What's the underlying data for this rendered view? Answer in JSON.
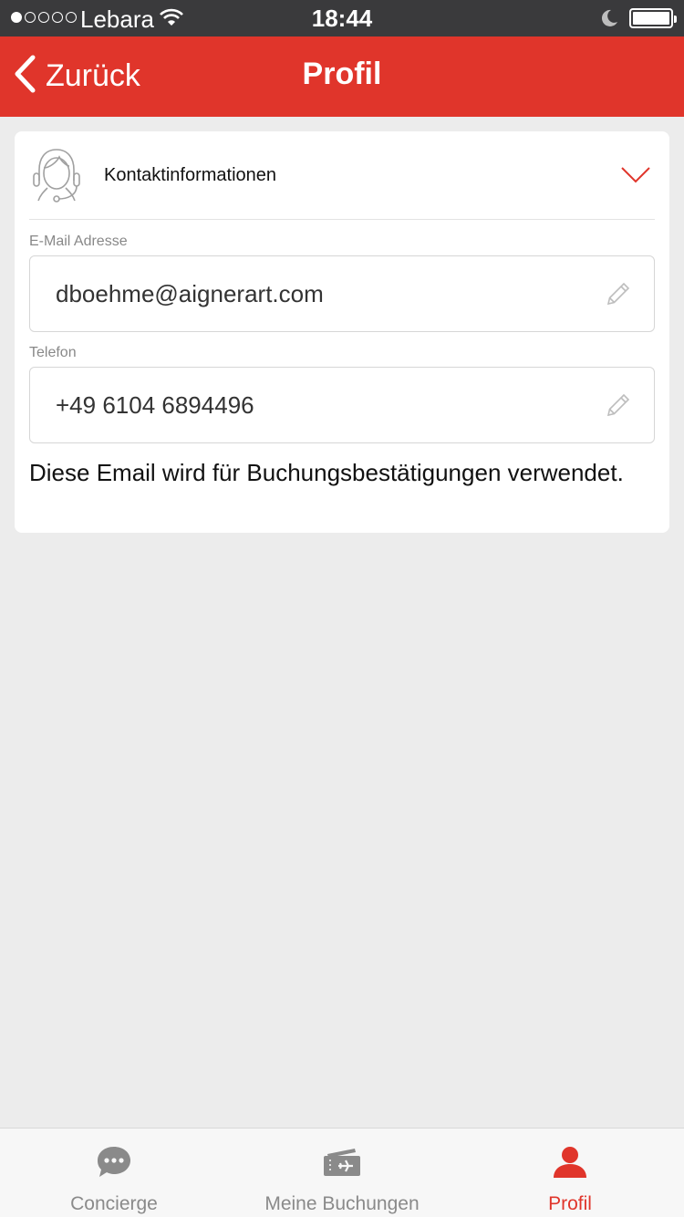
{
  "status_bar": {
    "carrier": "Lebara",
    "time": "18:44",
    "signal_bars_filled": 1,
    "signal_bars_total": 5,
    "battery_level": 1.0
  },
  "nav": {
    "back_label": "Zurück",
    "title": "Profil"
  },
  "contact": {
    "section_title": "Kontaktinformationen",
    "email_label": "E-Mail Adresse",
    "email_value": "dboehme@aignerart.com",
    "phone_label": "Telefon",
    "phone_value": "+49 6104 6894496",
    "note": "Diese Email wird für Buchungsbestätigungen verwendet."
  },
  "tabs": [
    {
      "label": "Concierge",
      "icon": "chat-bubble-icon",
      "active": false
    },
    {
      "label": "Meine Buchungen",
      "icon": "ticket-plane-icon",
      "active": false
    },
    {
      "label": "Profil",
      "icon": "person-icon",
      "active": true
    }
  ],
  "colors": {
    "accent": "#e0352b",
    "status_bar": "#3a3a3c",
    "background": "#ececec",
    "inactive_tab": "#8a8a8a"
  }
}
